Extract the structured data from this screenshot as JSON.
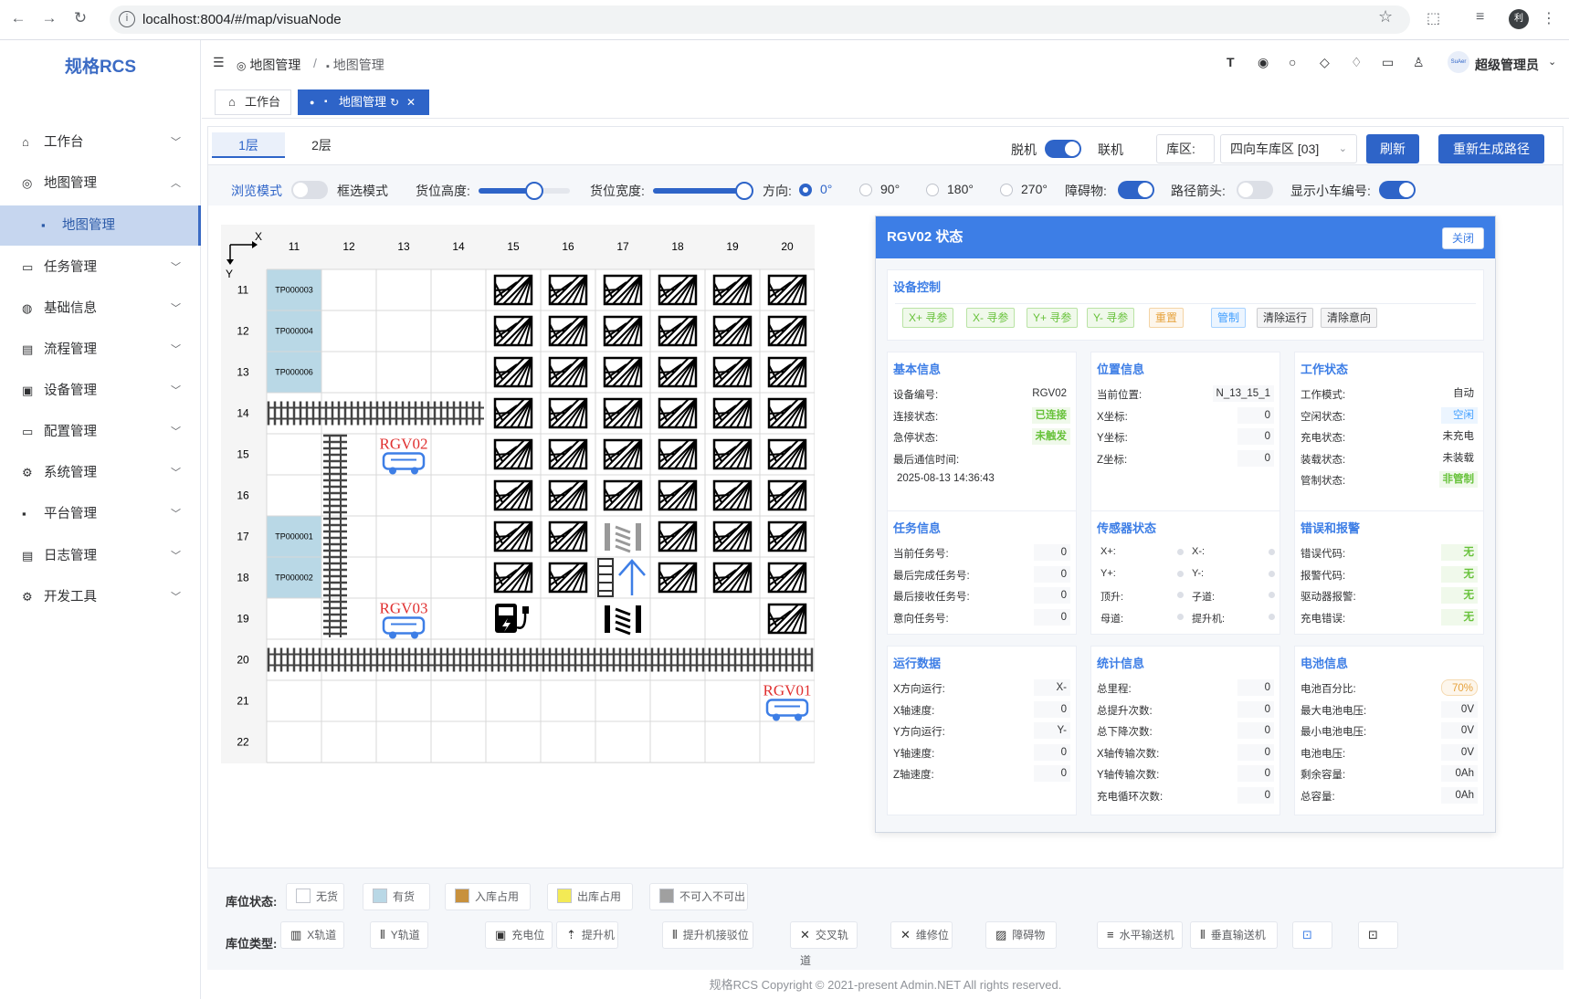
{
  "browser": {
    "url": "localhost:8004/#/map/visuaNode",
    "profile_initial": "利"
  },
  "app": {
    "logo": "规格RCS"
  },
  "sidebar": {
    "items": [
      {
        "label": "工作台",
        "icon": "home-icon",
        "glyph": "⌂",
        "expanded": false
      },
      {
        "label": "地图管理",
        "icon": "map-icon",
        "glyph": "◎",
        "expanded": true
      },
      {
        "label": "地图管理",
        "icon": "grid-icon",
        "glyph": "▪",
        "sub": true
      },
      {
        "label": "任务管理",
        "icon": "monitor-icon",
        "glyph": "▭",
        "expanded": false
      },
      {
        "label": "基础信息",
        "icon": "info-icon",
        "glyph": "◍",
        "expanded": false
      },
      {
        "label": "流程管理",
        "icon": "calendar-icon",
        "glyph": "▤",
        "expanded": false
      },
      {
        "label": "设备管理",
        "icon": "device-icon",
        "glyph": "▣",
        "expanded": false
      },
      {
        "label": "配置管理",
        "icon": "config-icon",
        "glyph": "▭",
        "expanded": false
      },
      {
        "label": "系统管理",
        "icon": "gear-icon",
        "glyph": "⚙",
        "expanded": false
      },
      {
        "label": "平台管理",
        "icon": "apps-icon",
        "glyph": "▪",
        "expanded": false
      },
      {
        "label": "日志管理",
        "icon": "log-icon",
        "glyph": "▤",
        "expanded": false
      },
      {
        "label": "开发工具",
        "icon": "tools-icon",
        "glyph": "⚙",
        "expanded": false
      }
    ]
  },
  "header": {
    "breadcrumb": [
      "地图管理",
      "地图管理"
    ],
    "user": "超级管理员",
    "avatar_text": "SuAer"
  },
  "tabs": [
    {
      "label": "工作台"
    },
    {
      "label": "地图管理"
    }
  ],
  "toolbar": {
    "floors": [
      "1层",
      "2层"
    ],
    "offline": "脱机",
    "online": "联机",
    "zone_label": "库区:",
    "zone_value": "四向车库区 [03]",
    "refresh": "刷新",
    "regen": "重新生成路径",
    "browse_mode": "浏览模式",
    "select_mode": "框选模式",
    "slot_height": "货位高度:",
    "slot_width": "货位宽度:",
    "direction": "方向:",
    "angles": [
      "0°",
      "90°",
      "180°",
      "270°"
    ],
    "obstacle": "障碍物:",
    "path_arrow": "路径箭头:",
    "show_car_no": "显示小车编号:",
    "slot_height_level": 0.61,
    "slot_width_level": 1.0
  },
  "map": {
    "cols": [
      "11",
      "12",
      "13",
      "14",
      "15",
      "16",
      "17",
      "18",
      "19",
      "20"
    ],
    "rows": [
      "11",
      "12",
      "13",
      "14",
      "15",
      "16",
      "17",
      "18",
      "19",
      "20",
      "21",
      "22"
    ],
    "axis_x": "X",
    "axis_y": "Y",
    "tp_cells": [
      {
        "r": 0,
        "label": "TP000003"
      },
      {
        "r": 1,
        "label": "TP000004"
      },
      {
        "r": 2,
        "label": "TP000006"
      },
      {
        "r": 6,
        "label": "TP000001"
      },
      {
        "r": 7,
        "label": "TP000002"
      }
    ],
    "cars": [
      {
        "label": "RGV02"
      },
      {
        "label": "RGV03"
      },
      {
        "label": "RGV01"
      }
    ]
  },
  "panel": {
    "title": "RGV02 状态",
    "close": "关闭",
    "control": {
      "title": "设备控制",
      "buttons": [
        "X+ 寻参",
        "X- 寻参",
        "Y+ 寻参",
        "Y- 寻参",
        "重置",
        "管制",
        "清除运行",
        "清除意向"
      ]
    },
    "basic": {
      "title": "基本信息",
      "rows": [
        [
          "设备编号:",
          "RGV02"
        ],
        [
          "连接状态:",
          "已连接"
        ],
        [
          "急停状态:",
          "未触发"
        ],
        [
          "最后通信时间:",
          ""
        ]
      ],
      "time": "2025-08-13 14:36:43"
    },
    "position": {
      "title": "位置信息",
      "rows": [
        [
          "当前位置:",
          "N_13_15_1"
        ],
        [
          "X坐标:",
          "0"
        ],
        [
          "Y坐标:",
          "0"
        ],
        [
          "Z坐标:",
          "0"
        ]
      ]
    },
    "work": {
      "title": "工作状态",
      "rows": [
        [
          "工作模式:",
          "自动"
        ],
        [
          "空闲状态:",
          "空闲"
        ],
        [
          "充电状态:",
          "未充电"
        ],
        [
          "装载状态:",
          "未装载"
        ],
        [
          "管制状态:",
          "非管制"
        ]
      ]
    },
    "task": {
      "title": "任务信息",
      "rows": [
        [
          "当前任务号:",
          "0"
        ],
        [
          "最后完成任务号:",
          "0"
        ],
        [
          "最后接收任务号:",
          "0"
        ],
        [
          "意向任务号:",
          "0"
        ]
      ]
    },
    "sensor": {
      "title": "传感器状态",
      "rows": [
        [
          "X+:",
          "X-:"
        ],
        [
          "Y+:",
          "Y-:"
        ],
        [
          "顶升:",
          "子道:"
        ],
        [
          "母道:",
          "提升机:"
        ]
      ]
    },
    "error": {
      "title": "错误和报警",
      "rows": [
        [
          "错误代码:",
          "无"
        ],
        [
          "报警代码:",
          "无"
        ],
        [
          "驱动器报警:",
          "无"
        ],
        [
          "充电错误:",
          "无"
        ]
      ]
    },
    "run": {
      "title": "运行数据",
      "rows": [
        [
          "X方向运行:",
          "X-"
        ],
        [
          "X轴速度:",
          "0"
        ],
        [
          "Y方向运行:",
          "Y-"
        ],
        [
          "Y轴速度:",
          "0"
        ],
        [
          "Z轴速度:",
          "0"
        ]
      ]
    },
    "stats": {
      "title": "统计信息",
      "rows": [
        [
          "总里程:",
          "0"
        ],
        [
          "总提升次数:",
          "0"
        ],
        [
          "总下降次数:",
          "0"
        ],
        [
          "X轴传输次数:",
          "0"
        ],
        [
          "Y轴传输次数:",
          "0"
        ],
        [
          "充电循环次数:",
          "0"
        ]
      ]
    },
    "battery": {
      "title": "电池信息",
      "rows": [
        [
          "电池百分比:",
          "70%"
        ],
        [
          "最大电池电压:",
          "0V"
        ],
        [
          "最小电池电压:",
          "0V"
        ],
        [
          "电池电压:",
          "0V"
        ],
        [
          "剩余容量:",
          "0Ah"
        ],
        [
          "总容量:",
          "0Ah"
        ]
      ]
    }
  },
  "legend": {
    "status_label": "库位状态:",
    "type_label": "库位类型:",
    "status": [
      {
        "label": "无货",
        "color": "#ffffff"
      },
      {
        "label": "有货",
        "color": "#b9d8e6"
      },
      {
        "label": "入库占用",
        "color": "#c8913d"
      },
      {
        "label": "出库占用",
        "color": "#f3ea55"
      },
      {
        "label": "不可入不可出",
        "color": "#a0a0a0"
      }
    ],
    "types": [
      "X轨道",
      "Y轨道",
      "充电位",
      "提升机",
      "提升机接驳位",
      "交叉轨道",
      "维修位",
      "障碍物",
      "水平输送机",
      "垂直输送机",
      "",
      ""
    ]
  },
  "footer": "规格RCS Copyright © 2021-present Admin.NET All rights reserved."
}
